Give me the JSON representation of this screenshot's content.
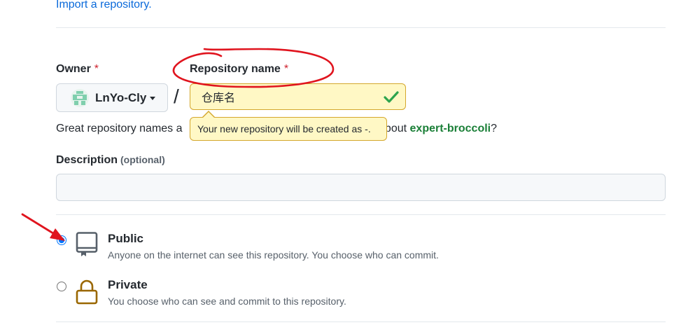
{
  "import_link": "Import a repository.",
  "owner": {
    "label": "Owner",
    "required_mark": "*",
    "selected": "LnYo-Cly",
    "avatar_icon": "identicon-avatar"
  },
  "separator": "/",
  "repo_name": {
    "label": "Repository name",
    "required_mark": "*",
    "value": "仓库名",
    "valid": true
  },
  "tooltip": "Your new repository will be created as -.",
  "hint": {
    "before": "Great repository names a",
    "after": "ation? How about ",
    "suggestion": "expert-broccoli",
    "end": "?"
  },
  "description": {
    "label": "Description",
    "optional": "(optional)",
    "value": ""
  },
  "visibility": [
    {
      "title": "Public",
      "description": "Anyone on the internet can see this repository. You choose who can commit.",
      "checked": true,
      "icon": "repo-book-icon"
    },
    {
      "title": "Private",
      "description": "You choose who can see and commit to this repository.",
      "checked": false,
      "icon": "lock-icon"
    }
  ],
  "colors": {
    "link": "#0969da",
    "required": "#cf222e",
    "success": "#1a7f37",
    "warning_bg": "#fff8c5",
    "warning_border": "#d4a72c",
    "lock": "#9a6700",
    "annotation": "#e0141e"
  }
}
